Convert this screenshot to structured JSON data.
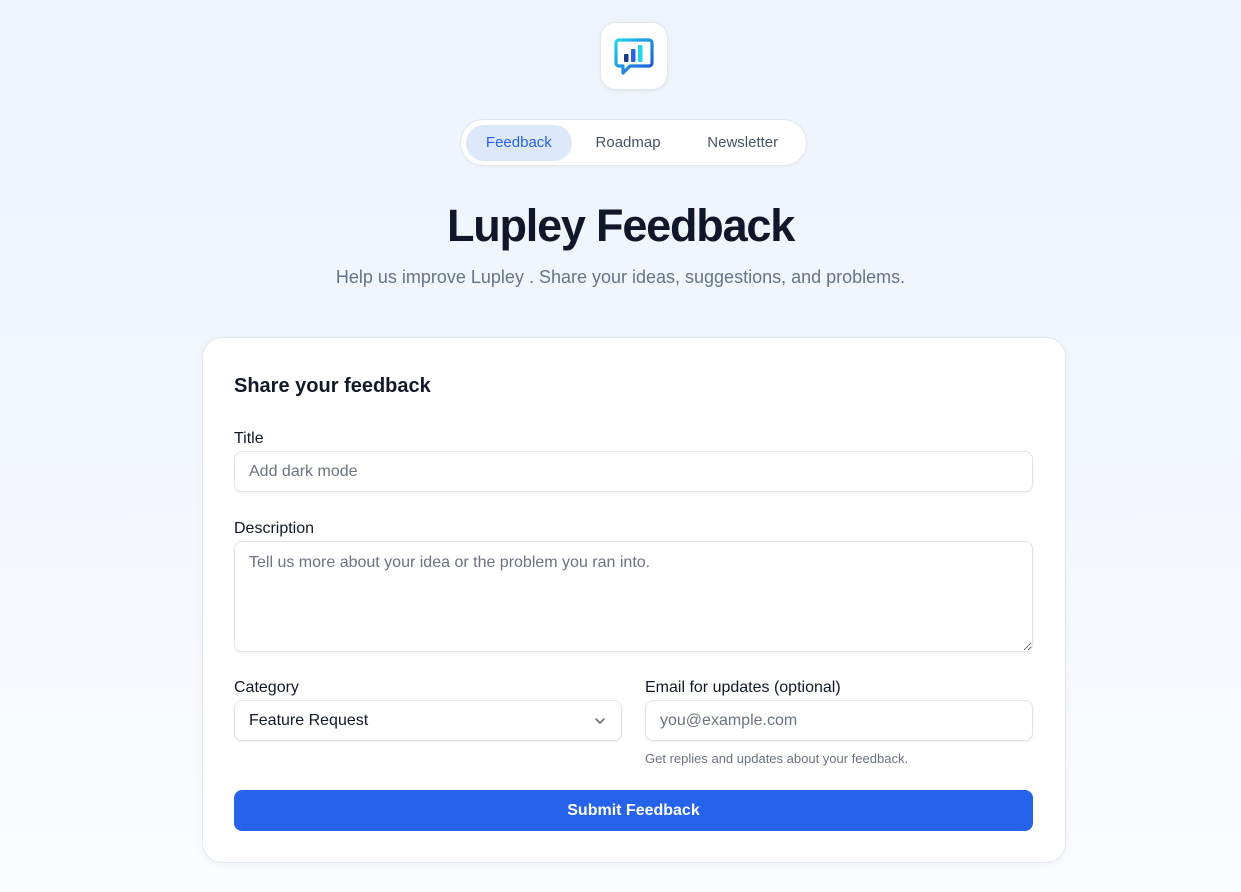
{
  "app": {
    "logo_icon": "chat-bar-chart-icon"
  },
  "nav": {
    "tabs": [
      {
        "label": "Feedback",
        "active": true
      },
      {
        "label": "Roadmap",
        "active": false
      },
      {
        "label": "Newsletter",
        "active": false
      }
    ]
  },
  "header": {
    "title": "Lupley Feedback",
    "subtitle": "Help us improve Lupley . Share your ideas, suggestions, and problems."
  },
  "form": {
    "heading": "Share your feedback",
    "title_label": "Title",
    "title_placeholder": "Add dark mode",
    "description_label": "Description",
    "description_placeholder": "Tell us more about your idea or the problem you ran into.",
    "category_label": "Category",
    "category_value": "Feature Request",
    "email_label": "Email for updates (optional)",
    "email_placeholder": "you@example.com",
    "email_help": "Get replies and updates about your feedback.",
    "submit_label": "Submit Feedback"
  },
  "colors": {
    "accent": "#2563eb",
    "active_tab_bg": "#dde8fa",
    "page_bg": "#eef4fd"
  }
}
